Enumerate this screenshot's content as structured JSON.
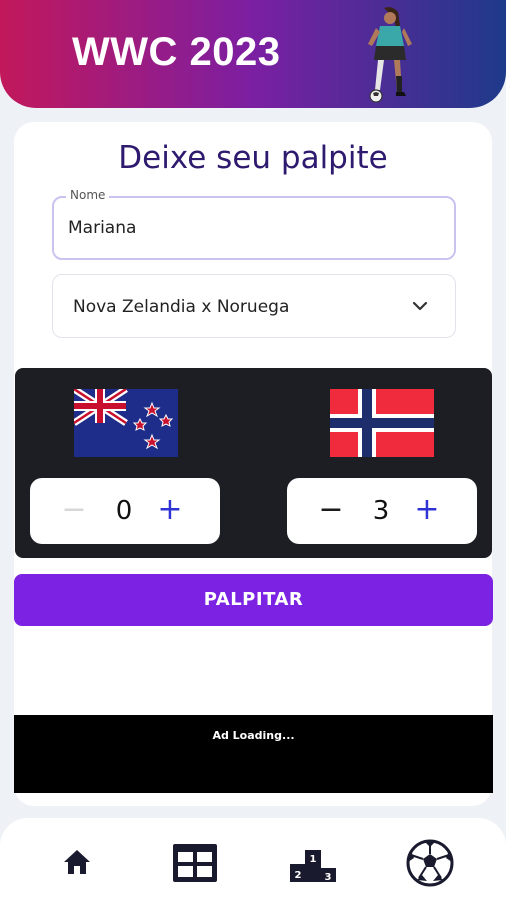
{
  "header": {
    "title": "WWC 2023",
    "player_icon": "soccer-player-icon"
  },
  "form": {
    "title": "Deixe seu palpite",
    "name_label": "Nome",
    "name_value": "Mariana",
    "match_select": {
      "selected": "Nova Zelandia x Noruega",
      "icon": "chevron-down-icon"
    }
  },
  "score": {
    "home": {
      "flag": "new-zealand-flag",
      "value": "0",
      "minus": "−",
      "plus": "+"
    },
    "away": {
      "flag": "norway-flag",
      "value": "3",
      "minus": "−",
      "plus": "+"
    }
  },
  "submit_label": "PALPITAR",
  "ad": {
    "text": "Ad Loading..."
  },
  "nav": {
    "items": [
      {
        "icon": "home-icon"
      },
      {
        "icon": "table-icon"
      },
      {
        "icon": "podium-icon"
      },
      {
        "icon": "soccer-ball-icon"
      }
    ],
    "podium_numbers": [
      "1",
      "2",
      "3"
    ]
  },
  "colors": {
    "header_gradient": [
      "#c2185b",
      "#7b1fa2",
      "#1e3a8a"
    ],
    "title": "#2e1a6e",
    "submit": "#7b22e3",
    "plus": "#2f33d6",
    "panel": "#1c1e24"
  }
}
